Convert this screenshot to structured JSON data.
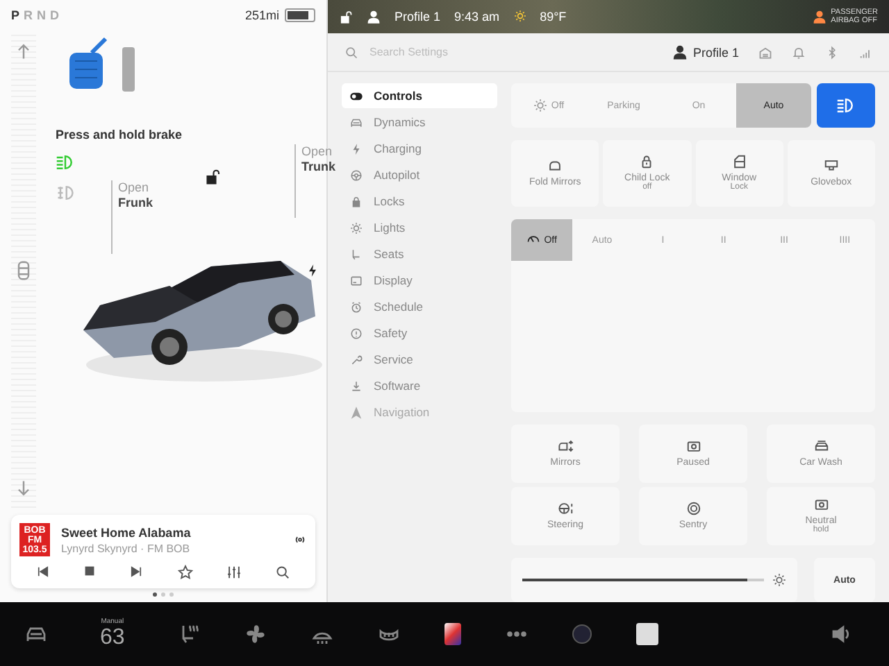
{
  "left_panel": {
    "gears": [
      {
        "label": "P",
        "selected": true
      },
      {
        "label": "R",
        "selected": false
      },
      {
        "label": "N",
        "selected": false
      },
      {
        "label": "D",
        "selected": false
      }
    ],
    "range": "251mi",
    "brake_hint": "Press and hold brake",
    "frunk": {
      "action": "Open",
      "label": "Frunk"
    },
    "trunk": {
      "action": "Open",
      "label": "Trunk"
    },
    "media": {
      "station_logo": [
        "BOB",
        "FM",
        "103.5"
      ],
      "title": "Sweet Home Alabama",
      "subtitle": "Lynyrd Skynyrd · FM BOB"
    },
    "page_dots": [
      {
        "selected": true
      },
      {
        "selected": false
      },
      {
        "selected": false
      }
    ]
  },
  "status_bar": {
    "profile": "Profile 1",
    "time": "9:43 am",
    "temperature": "89°F",
    "airbag": [
      "PASSENGER",
      "AIRBAG OFF"
    ]
  },
  "settings": {
    "search": {
      "placeholder": "Search Settings"
    },
    "profile": "Profile 1",
    "menu": [
      {
        "label": "Controls",
        "selected": true,
        "disabled": false
      },
      {
        "label": "Dynamics",
        "selected": false,
        "disabled": false
      },
      {
        "label": "Charging",
        "selected": false,
        "disabled": false
      },
      {
        "label": "Autopilot",
        "selected": false,
        "disabled": false
      },
      {
        "label": "Locks",
        "selected": false,
        "disabled": false
      },
      {
        "label": "Lights",
        "selected": false,
        "disabled": false
      },
      {
        "label": "Seats",
        "selected": false,
        "disabled": false
      },
      {
        "label": "Display",
        "selected": false,
        "disabled": false
      },
      {
        "label": "Schedule",
        "selected": false,
        "disabled": false
      },
      {
        "label": "Safety",
        "selected": false,
        "disabled": false
      },
      {
        "label": "Service",
        "selected": false,
        "disabled": false
      },
      {
        "label": "Software",
        "selected": false,
        "disabled": false
      },
      {
        "label": "Navigation",
        "selected": false,
        "disabled": true
      }
    ],
    "headlights": [
      {
        "label": "Off",
        "selected": false
      },
      {
        "label": "Parking",
        "selected": false
      },
      {
        "label": "On",
        "selected": false
      },
      {
        "label": "Auto",
        "selected": true
      }
    ],
    "auto_high_beam": {
      "on": true
    },
    "tiles": [
      {
        "label": "Fold Mirrors"
      },
      {
        "label": "Child Lock",
        "sub": "off"
      },
      {
        "label": "Window",
        "sub": "Lock"
      },
      {
        "label": "Glovebox"
      }
    ],
    "wipers": [
      {
        "label": "Off",
        "selected": true
      },
      {
        "label": "Auto",
        "selected": false
      },
      {
        "label": "I",
        "selected": false
      },
      {
        "label": "II",
        "selected": false
      },
      {
        "label": "III",
        "selected": false
      },
      {
        "label": "IIII",
        "selected": false
      }
    ],
    "tiles_2": [
      {
        "label": "Mirrors"
      },
      {
        "label": "Paused"
      },
      {
        "label": "Car Wash"
      },
      {
        "label": "Steering"
      },
      {
        "label": "Sentry"
      },
      {
        "label": "Neutral",
        "sub": "hold"
      }
    ],
    "brightness": {
      "level": 0.93
    },
    "brightness_auto": "Auto"
  },
  "dock": {
    "climate_mode": "Manual",
    "temperature": "63"
  }
}
